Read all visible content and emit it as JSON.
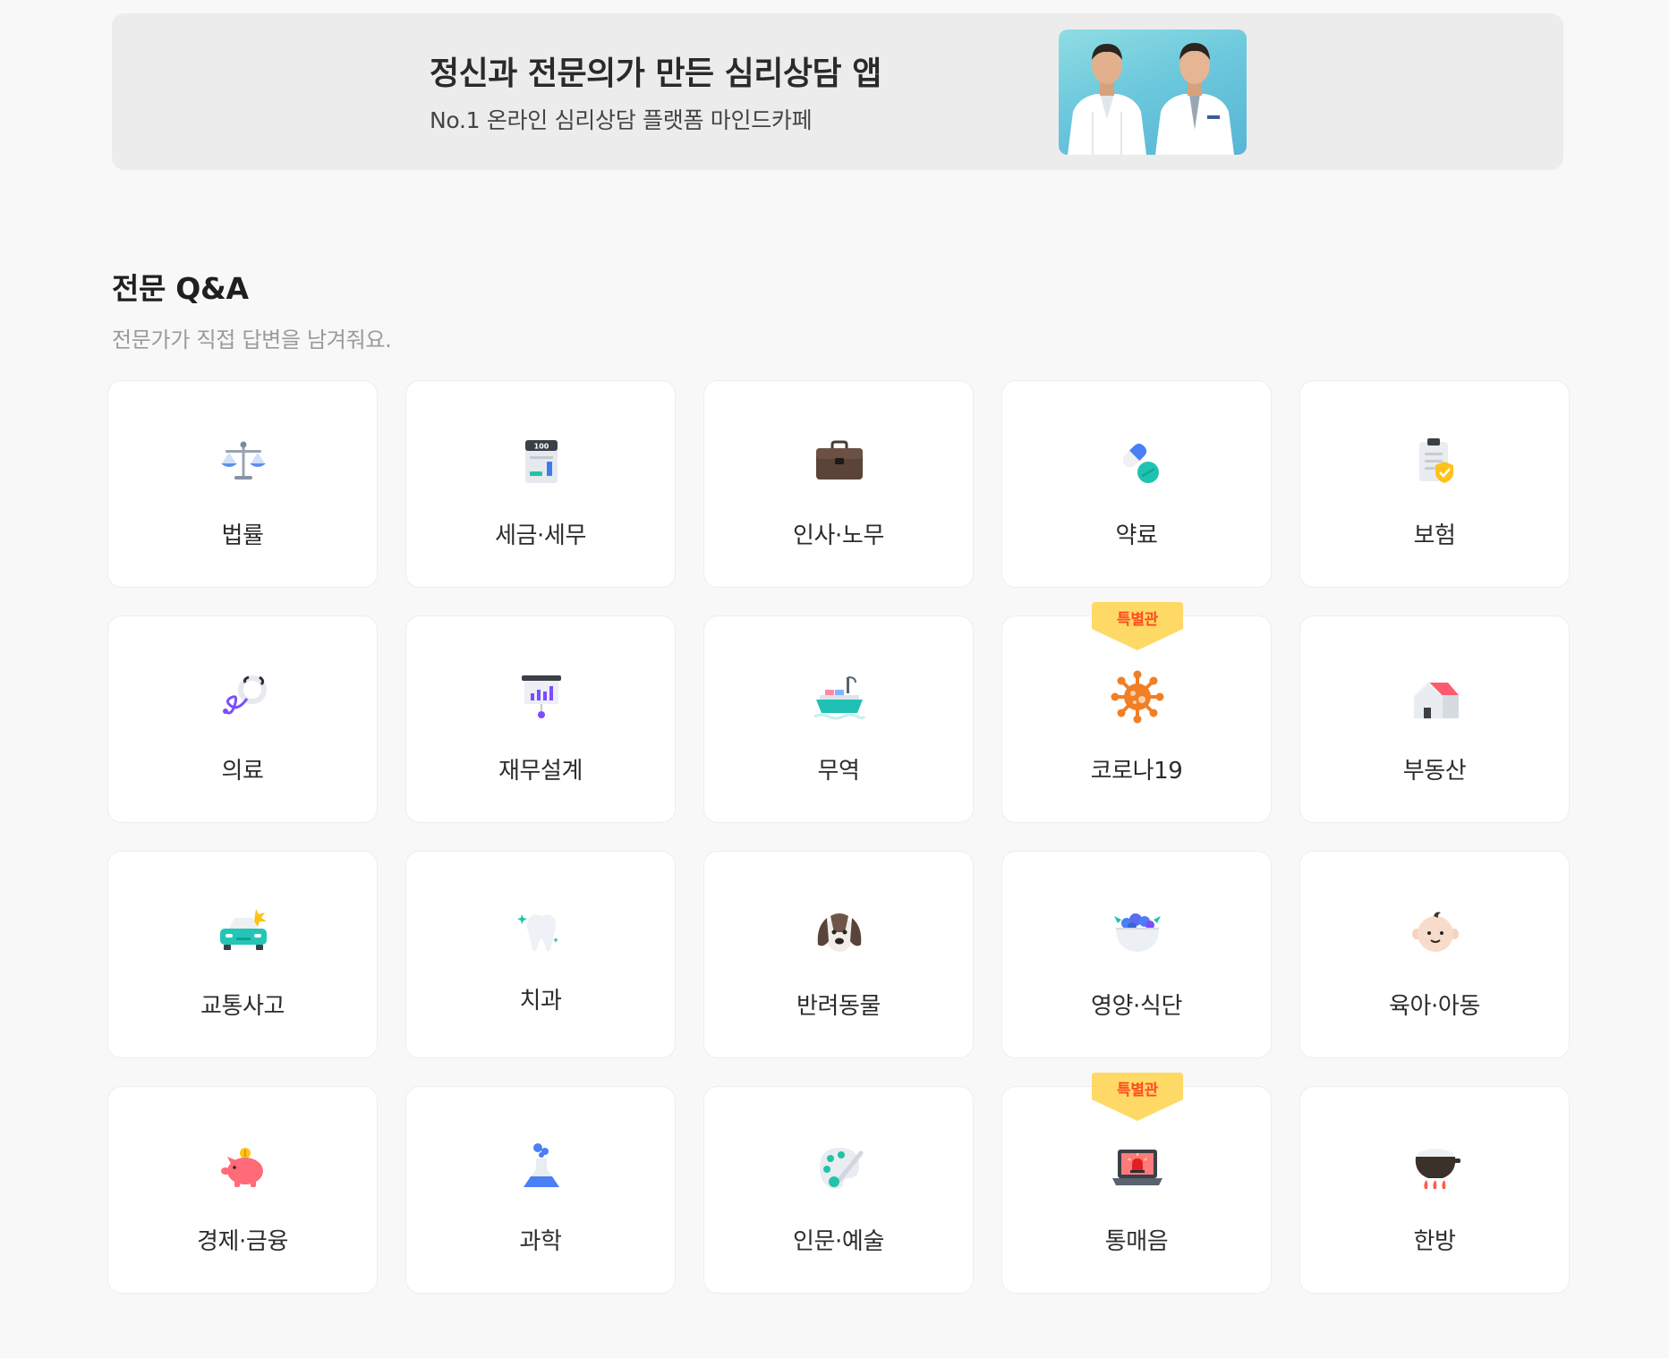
{
  "banner": {
    "title": "정신과 전문의가 만든 심리상담 앱",
    "subtitle": "No.1 온라인 심리상담 플랫폼 마인드카페"
  },
  "section": {
    "title": "전문 Q&A",
    "subtitle": "전문가가 직접 답변을 남겨줘요."
  },
  "badge_label": "특별관",
  "categories": [
    {
      "label": "법률",
      "icon": "scales-icon"
    },
    {
      "label": "세금·세무",
      "icon": "tax-document-icon"
    },
    {
      "label": "인사·노무",
      "icon": "briefcase-icon"
    },
    {
      "label": "약료",
      "icon": "pill-icon"
    },
    {
      "label": "보험",
      "icon": "insurance-clipboard-icon"
    },
    {
      "label": "의료",
      "icon": "stethoscope-icon"
    },
    {
      "label": "재무설계",
      "icon": "finance-board-icon"
    },
    {
      "label": "무역",
      "icon": "cargo-ship-icon"
    },
    {
      "label": "코로나19",
      "icon": "virus-icon",
      "badge": true
    },
    {
      "label": "부동산",
      "icon": "house-icon"
    },
    {
      "label": "교통사고",
      "icon": "car-crash-icon"
    },
    {
      "label": "치과",
      "icon": "tooth-icon"
    },
    {
      "label": "반려동물",
      "icon": "dog-icon"
    },
    {
      "label": "영양·식단",
      "icon": "salad-bowl-icon"
    },
    {
      "label": "육아·아동",
      "icon": "baby-icon"
    },
    {
      "label": "경제·금융",
      "icon": "piggy-bank-icon"
    },
    {
      "label": "과학",
      "icon": "flask-icon"
    },
    {
      "label": "인문·예술",
      "icon": "paint-palette-icon"
    },
    {
      "label": "통매음",
      "icon": "siren-laptop-icon",
      "badge": true
    },
    {
      "label": "한방",
      "icon": "herbal-pot-icon"
    }
  ]
}
